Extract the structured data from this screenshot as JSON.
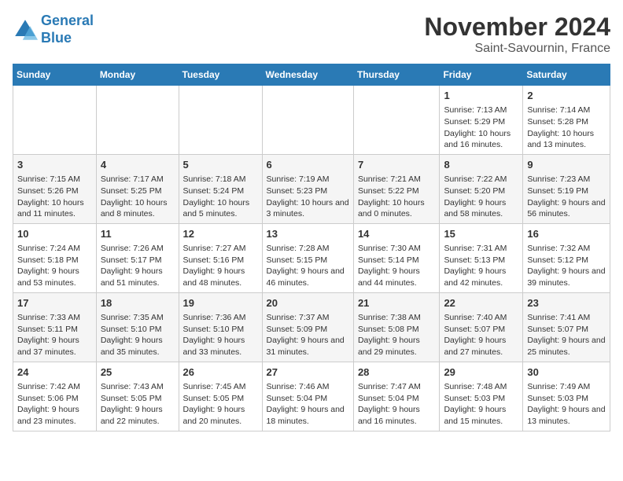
{
  "logo": {
    "line1": "General",
    "line2": "Blue"
  },
  "header": {
    "month": "November 2024",
    "location": "Saint-Savournin, France"
  },
  "weekdays": [
    "Sunday",
    "Monday",
    "Tuesday",
    "Wednesday",
    "Thursday",
    "Friday",
    "Saturday"
  ],
  "weeks": [
    [
      {
        "day": "",
        "info": ""
      },
      {
        "day": "",
        "info": ""
      },
      {
        "day": "",
        "info": ""
      },
      {
        "day": "",
        "info": ""
      },
      {
        "day": "",
        "info": ""
      },
      {
        "day": "1",
        "info": "Sunrise: 7:13 AM\nSunset: 5:29 PM\nDaylight: 10 hours and 16 minutes."
      },
      {
        "day": "2",
        "info": "Sunrise: 7:14 AM\nSunset: 5:28 PM\nDaylight: 10 hours and 13 minutes."
      }
    ],
    [
      {
        "day": "3",
        "info": "Sunrise: 7:15 AM\nSunset: 5:26 PM\nDaylight: 10 hours and 11 minutes."
      },
      {
        "day": "4",
        "info": "Sunrise: 7:17 AM\nSunset: 5:25 PM\nDaylight: 10 hours and 8 minutes."
      },
      {
        "day": "5",
        "info": "Sunrise: 7:18 AM\nSunset: 5:24 PM\nDaylight: 10 hours and 5 minutes."
      },
      {
        "day": "6",
        "info": "Sunrise: 7:19 AM\nSunset: 5:23 PM\nDaylight: 10 hours and 3 minutes."
      },
      {
        "day": "7",
        "info": "Sunrise: 7:21 AM\nSunset: 5:22 PM\nDaylight: 10 hours and 0 minutes."
      },
      {
        "day": "8",
        "info": "Sunrise: 7:22 AM\nSunset: 5:20 PM\nDaylight: 9 hours and 58 minutes."
      },
      {
        "day": "9",
        "info": "Sunrise: 7:23 AM\nSunset: 5:19 PM\nDaylight: 9 hours and 56 minutes."
      }
    ],
    [
      {
        "day": "10",
        "info": "Sunrise: 7:24 AM\nSunset: 5:18 PM\nDaylight: 9 hours and 53 minutes."
      },
      {
        "day": "11",
        "info": "Sunrise: 7:26 AM\nSunset: 5:17 PM\nDaylight: 9 hours and 51 minutes."
      },
      {
        "day": "12",
        "info": "Sunrise: 7:27 AM\nSunset: 5:16 PM\nDaylight: 9 hours and 48 minutes."
      },
      {
        "day": "13",
        "info": "Sunrise: 7:28 AM\nSunset: 5:15 PM\nDaylight: 9 hours and 46 minutes."
      },
      {
        "day": "14",
        "info": "Sunrise: 7:30 AM\nSunset: 5:14 PM\nDaylight: 9 hours and 44 minutes."
      },
      {
        "day": "15",
        "info": "Sunrise: 7:31 AM\nSunset: 5:13 PM\nDaylight: 9 hours and 42 minutes."
      },
      {
        "day": "16",
        "info": "Sunrise: 7:32 AM\nSunset: 5:12 PM\nDaylight: 9 hours and 39 minutes."
      }
    ],
    [
      {
        "day": "17",
        "info": "Sunrise: 7:33 AM\nSunset: 5:11 PM\nDaylight: 9 hours and 37 minutes."
      },
      {
        "day": "18",
        "info": "Sunrise: 7:35 AM\nSunset: 5:10 PM\nDaylight: 9 hours and 35 minutes."
      },
      {
        "day": "19",
        "info": "Sunrise: 7:36 AM\nSunset: 5:10 PM\nDaylight: 9 hours and 33 minutes."
      },
      {
        "day": "20",
        "info": "Sunrise: 7:37 AM\nSunset: 5:09 PM\nDaylight: 9 hours and 31 minutes."
      },
      {
        "day": "21",
        "info": "Sunrise: 7:38 AM\nSunset: 5:08 PM\nDaylight: 9 hours and 29 minutes."
      },
      {
        "day": "22",
        "info": "Sunrise: 7:40 AM\nSunset: 5:07 PM\nDaylight: 9 hours and 27 minutes."
      },
      {
        "day": "23",
        "info": "Sunrise: 7:41 AM\nSunset: 5:07 PM\nDaylight: 9 hours and 25 minutes."
      }
    ],
    [
      {
        "day": "24",
        "info": "Sunrise: 7:42 AM\nSunset: 5:06 PM\nDaylight: 9 hours and 23 minutes."
      },
      {
        "day": "25",
        "info": "Sunrise: 7:43 AM\nSunset: 5:05 PM\nDaylight: 9 hours and 22 minutes."
      },
      {
        "day": "26",
        "info": "Sunrise: 7:45 AM\nSunset: 5:05 PM\nDaylight: 9 hours and 20 minutes."
      },
      {
        "day": "27",
        "info": "Sunrise: 7:46 AM\nSunset: 5:04 PM\nDaylight: 9 hours and 18 minutes."
      },
      {
        "day": "28",
        "info": "Sunrise: 7:47 AM\nSunset: 5:04 PM\nDaylight: 9 hours and 16 minutes."
      },
      {
        "day": "29",
        "info": "Sunrise: 7:48 AM\nSunset: 5:03 PM\nDaylight: 9 hours and 15 minutes."
      },
      {
        "day": "30",
        "info": "Sunrise: 7:49 AM\nSunset: 5:03 PM\nDaylight: 9 hours and 13 minutes."
      }
    ]
  ]
}
